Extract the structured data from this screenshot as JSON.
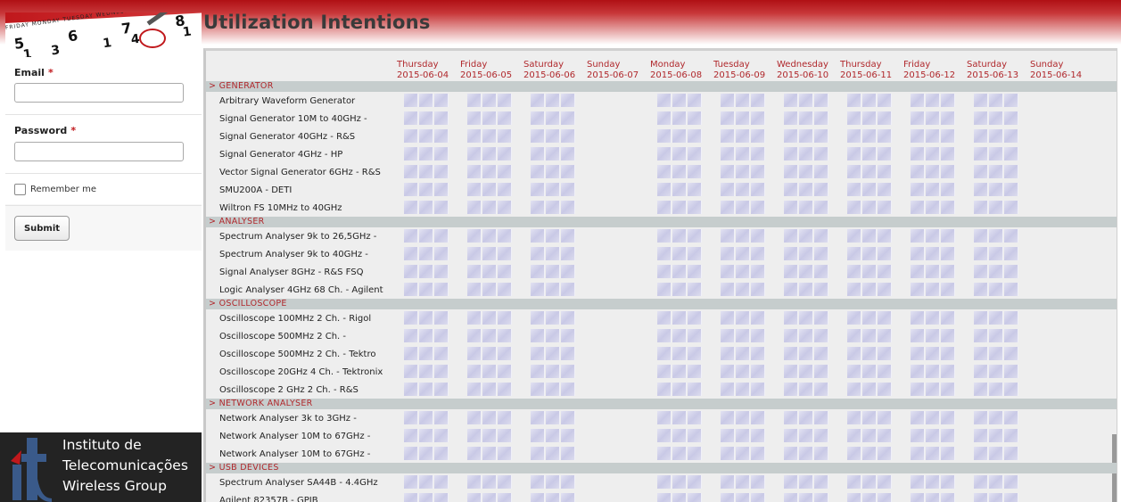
{
  "page_title": "Utilization Intentions",
  "calendar_banner": {
    "weekday_strip": "FRIDAY  MONDAY  TUESDAY  WEDNESDAY  THU",
    "numbers": "5 6 7 8",
    "numbers_row2": "13 14 15"
  },
  "login": {
    "email_label": "Email",
    "email_required": "*",
    "email_value": "",
    "password_label": "Password",
    "password_required": "*",
    "password_value": "",
    "remember_label": "Remember me",
    "submit_label": "Submit"
  },
  "logo": {
    "lines": [
      "Instituto de",
      "Telecomunicações",
      "Wireless Group"
    ]
  },
  "schedule": {
    "days": [
      {
        "name": "Thursday",
        "date": "2015-06-04",
        "available": true
      },
      {
        "name": "Friday",
        "date": "2015-06-05",
        "available": true
      },
      {
        "name": "Saturday",
        "date": "2015-06-06",
        "available": true
      },
      {
        "name": "Sunday",
        "date": "2015-06-07",
        "available": false
      },
      {
        "name": "Monday",
        "date": "2015-06-08",
        "available": true
      },
      {
        "name": "Tuesday",
        "date": "2015-06-09",
        "available": true
      },
      {
        "name": "Wednesday",
        "date": "2015-06-10",
        "available": true
      },
      {
        "name": "Thursday",
        "date": "2015-06-11",
        "available": true
      },
      {
        "name": "Friday",
        "date": "2015-06-12",
        "available": true
      },
      {
        "name": "Saturday",
        "date": "2015-06-13",
        "available": true
      },
      {
        "name": "Sunday",
        "date": "2015-06-14",
        "available": false
      }
    ],
    "categories": [
      {
        "name": "> GENERATOR",
        "items": [
          "Arbitrary Waveform Generator",
          "Signal Generator 10M to 40GHz -",
          "Signal Generator 40GHz - R&S",
          "Signal Generator 4GHz - HP",
          "Vector Signal Generator 6GHz - R&S",
          "SMU200A - DETI",
          "Wiltron FS 10MHz to 40GHz"
        ]
      },
      {
        "name": "> ANALYSER",
        "items": [
          "Spectrum Analyser 9k to 26,5GHz -",
          "Spectrum Analyser 9k to 40GHz -",
          "Signal Analyser 8GHz - R&S FSQ",
          "Logic Analyser 4GHz 68 Ch. - Agilent"
        ]
      },
      {
        "name": "> OSCILLOSCOPE",
        "items": [
          "Oscilloscope 100MHz 2 Ch. - Rigol",
          "Oscilloscope 500MHz 2 Ch. -",
          "Oscilloscope 500MHz 2 Ch. - Tektro",
          "Oscilloscope 20GHz 4 Ch. - Tektronix",
          "Oscilloscope 2 GHz 2 Ch. - R&S"
        ]
      },
      {
        "name": "> NETWORK ANALYSER",
        "items": [
          "Network Analyser 3k to 3GHz -",
          "Network Analyser 10M to 67GHz -",
          "Network Analyser 10M to 67GHz -"
        ]
      },
      {
        "name": "> USB DEVICES",
        "items": [
          "Spectrum Analyser SA44B - 4.4GHz",
          "Agilent 82357B - GPIB"
        ]
      }
    ]
  },
  "colors": {
    "accent_red": "#b0282c",
    "category_bar": "#c6cdcd",
    "slot_fill": "#c9c9e6"
  }
}
